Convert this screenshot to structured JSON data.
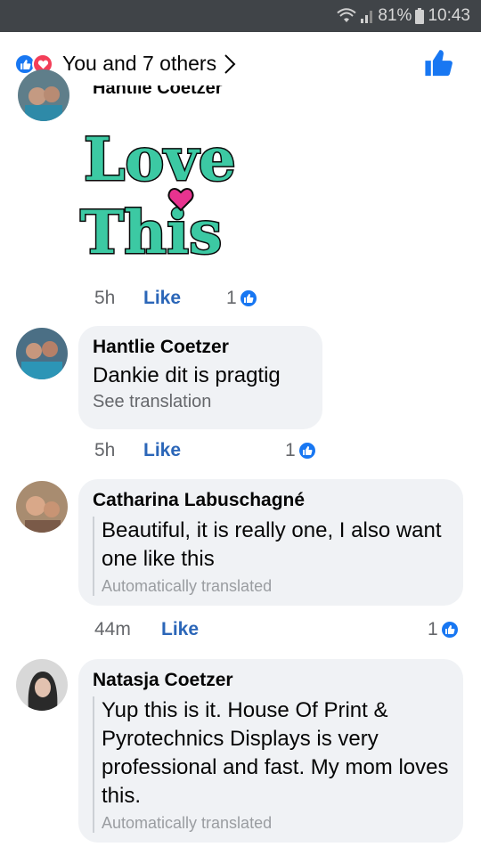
{
  "status_bar": {
    "battery": "81%",
    "time": "10:43"
  },
  "header": {
    "reactions_text": "You and 7 others",
    "like_icon": "thumbs-up-icon",
    "love_icon": "heart-icon"
  },
  "top_comment": {
    "author": "Hantlie Coetzer",
    "sticker_line1": "Love",
    "sticker_line2": "This",
    "time": "5h",
    "like_label": "Like",
    "reaction_count": "1"
  },
  "comments": [
    {
      "author": "Hantlie Coetzer",
      "text": "Dankie dit is pragtig",
      "translation_link": "See translation",
      "time": "5h",
      "like_label": "Like",
      "reaction_count": "1"
    },
    {
      "author": "Catharina Labuschagné",
      "translated_text": "Beautiful, it is really one, I also want one like this",
      "translation_note": "Automatically translated",
      "time": "44m",
      "like_label": "Like",
      "reaction_count": "1"
    },
    {
      "author": "Natasja Coetzer",
      "translated_text": "Yup this is it. House Of Print & Pyrotechnics Displays is very professional and fast. My mom loves this.",
      "translation_note": "Automatically translated"
    }
  ],
  "colors": {
    "accent": "#1877f2",
    "love": "#f33e58",
    "bubble": "#f0f2f5",
    "sticker_fill": "#3cc9a3",
    "sticker_heart": "#e8338f"
  }
}
